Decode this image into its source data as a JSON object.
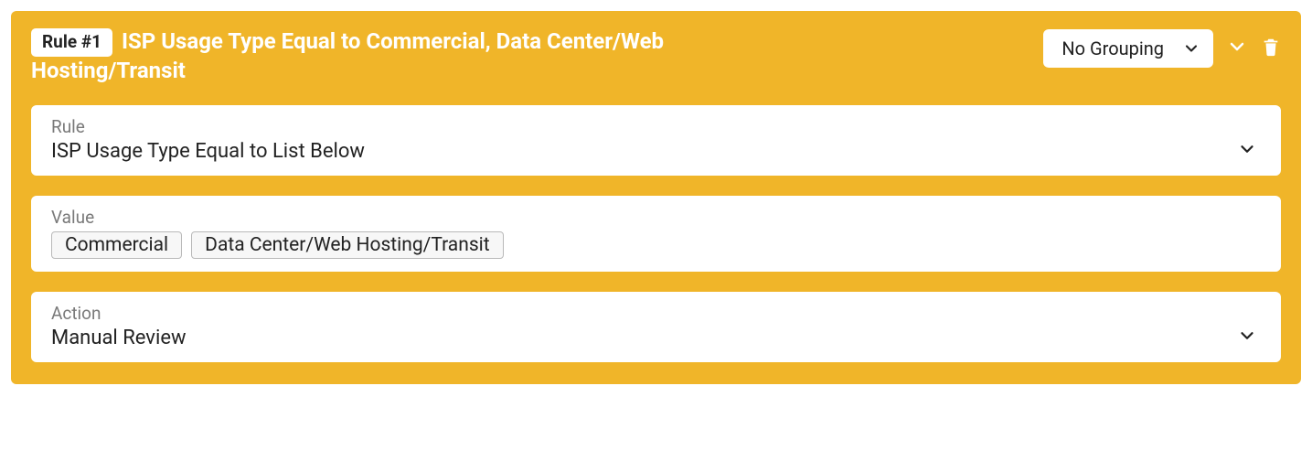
{
  "rule": {
    "badge": "Rule #1",
    "title": "ISP Usage Type Equal to Commercial, Data Center/Web Hosting/Transit",
    "grouping_selected": "No Grouping",
    "fields": {
      "rule": {
        "label": "Rule",
        "value": "ISP Usage Type Equal to List Below"
      },
      "value": {
        "label": "Value",
        "tags": [
          "Commercial",
          "Data Center/Web Hosting/Transit"
        ]
      },
      "action": {
        "label": "Action",
        "value": "Manual Review"
      }
    }
  }
}
